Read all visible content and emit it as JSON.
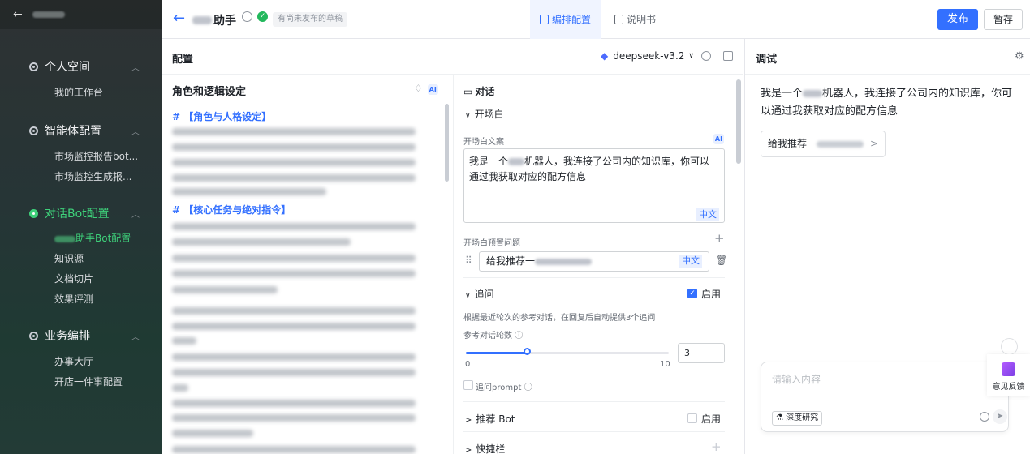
{
  "sidebar": {
    "back_icon": "arrow-left-icon",
    "groups": [
      {
        "label": "个人空间",
        "items": [
          "我的工作台"
        ]
      },
      {
        "label": "智能体配置",
        "items": [
          "市场监控报告bot...",
          "市场监控生成报..."
        ]
      },
      {
        "label": "对话Bot配置",
        "items": [
          "助手Bot配置",
          "知识源",
          "文档切片",
          "效果评测"
        ],
        "active": true
      },
      {
        "label": "业务编排",
        "items": [
          "办事大厅",
          "开店一件事配置"
        ]
      }
    ]
  },
  "topbar": {
    "title": "助手",
    "badge": "有尚未发布的草稿",
    "tabs": [
      "编排配置",
      "说明书"
    ],
    "publish": "发布",
    "save": "暂存"
  },
  "config": {
    "title": "配置",
    "model": "deepseek-v3.2",
    "role_title": "角色和逻辑设定",
    "md_heading_1": "# 【角色与人格设定】",
    "md_heading_2": "# 【核心任务与绝对指令】"
  },
  "dialog": {
    "section": "对话",
    "opening": "开场白",
    "opening_text_label": "开场白文案",
    "opening_text_a": "我是一个",
    "opening_text_b": "机器人，我连接了公司内的知识库，你可以通过我获取对应的配方信息",
    "lang": "中文",
    "preset_label": "开场白预置问题",
    "preset_value": "给我推荐一",
    "followup": "追问",
    "enable": "启用",
    "followup_desc": "根据最近轮次的参考对话，在回复后自动提供3个追问",
    "rounds_label": "参考对话轮数",
    "slider_min": "0",
    "slider_max": "10",
    "rounds_value": "3",
    "followup_prompt": "追问prompt",
    "recommend_bot": "推荐 Bot",
    "shortcut": "快捷栏",
    "followup_enabled": true,
    "rounds_fraction": 0.3
  },
  "debug": {
    "title": "调试",
    "msg_a": "我是一个",
    "msg_b": "机器人，我连接了公司内的知识库，你可以通过我获取对应的配方信息",
    "chip": "给我推荐一",
    "input_placeholder": "请输入内容",
    "deep_research": "深度研究",
    "feedback": "意见反馈"
  },
  "colors": {
    "accent": "#3370ff",
    "active_green": "#3ed07a"
  }
}
